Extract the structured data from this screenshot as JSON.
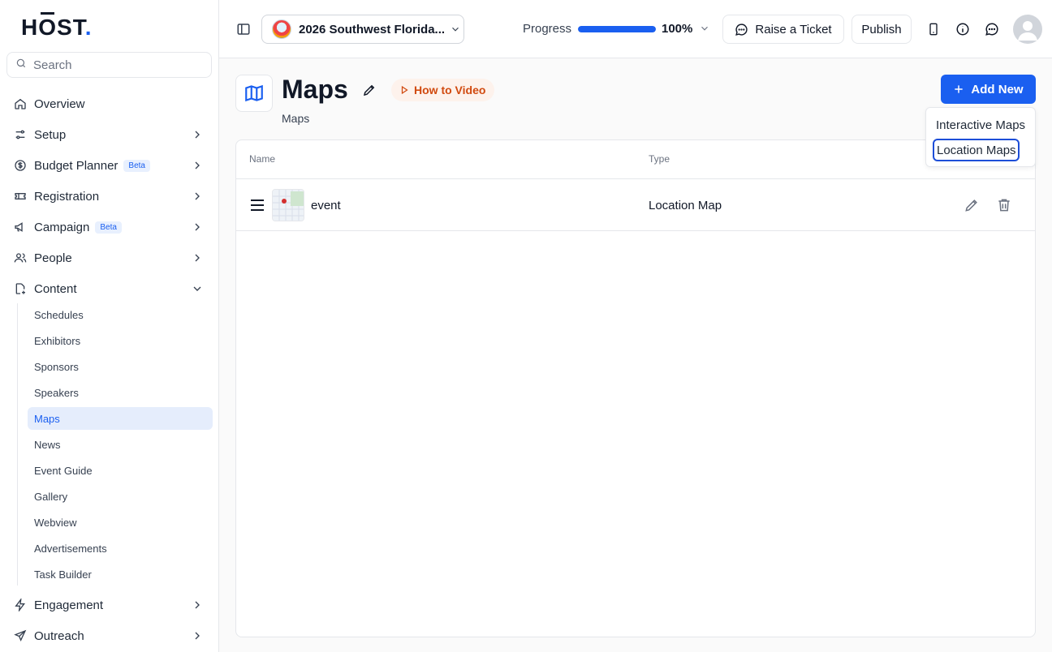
{
  "app": {
    "logo_prefix": "H",
    "logo_o": "O",
    "logo_suffix": "ST",
    "logo_dot": "."
  },
  "search": {
    "placeholder": "Search"
  },
  "sidebar": {
    "items": [
      {
        "label": "Overview"
      },
      {
        "label": "Setup"
      },
      {
        "label": "Budget Planner",
        "badge": "Beta"
      },
      {
        "label": "Registration"
      },
      {
        "label": "Campaign",
        "badge": "Beta"
      },
      {
        "label": "People"
      },
      {
        "label": "Content"
      },
      {
        "label": "Engagement"
      },
      {
        "label": "Outreach"
      }
    ],
    "content_sub": [
      "Schedules",
      "Exhibitors",
      "Sponsors",
      "Speakers",
      "Maps",
      "News",
      "Event Guide",
      "Gallery",
      "Webview",
      "Advertisements",
      "Task Builder"
    ],
    "active_sub": "Maps"
  },
  "topbar": {
    "event_name": "2026 Southwest Florida...",
    "progress_label": "Progress",
    "progress_value": "100%",
    "progress_fraction": 1.0,
    "raise_ticket": "Raise a Ticket",
    "publish": "Publish"
  },
  "page": {
    "title": "Maps",
    "how_to": "How to Video",
    "breadcrumb": "Maps",
    "add_new": "Add New"
  },
  "table": {
    "columns": [
      "Name",
      "Type"
    ],
    "rows": [
      {
        "name": "event",
        "type": "Location Map"
      }
    ]
  },
  "dropdown": {
    "items": [
      "Interactive Maps",
      "Location Maps"
    ]
  },
  "colors": {
    "accent": "#1a5ff0",
    "howto": "#d14a0f"
  }
}
